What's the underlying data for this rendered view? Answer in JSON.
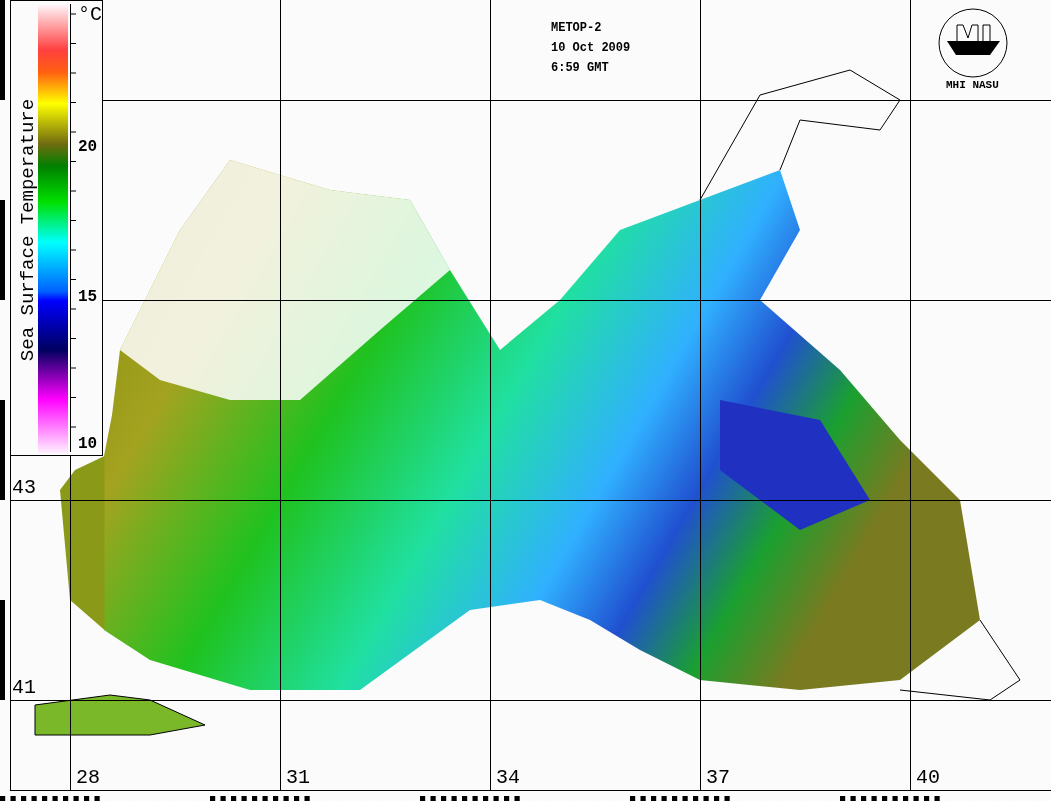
{
  "header": [
    "METOP-2",
    "10 Oct 2009",
    "6:59 GMT"
  ],
  "logo": {
    "caption": "MHI NASU"
  },
  "colorbar": {
    "title": "Sea Surface Temperature",
    "unit": "°C",
    "ticks": [
      "20",
      "15",
      "10"
    ]
  },
  "lat_labels": [
    "43",
    "41"
  ],
  "lon_labels": [
    "28",
    "31",
    "34",
    "37",
    "40"
  ]
}
